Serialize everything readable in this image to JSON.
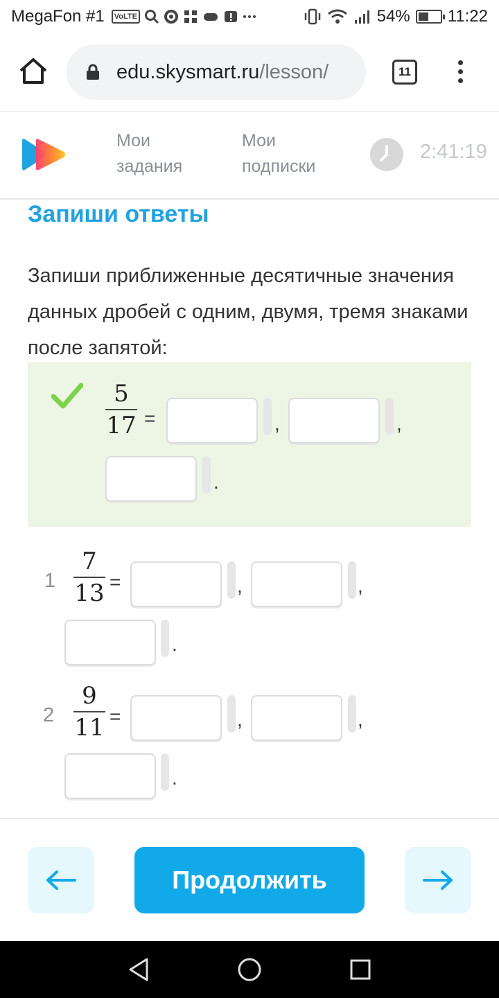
{
  "status_bar": {
    "carrier": "MegaFon #1",
    "volte": "VoLTE",
    "battery_percent": "54%",
    "battery_level": 0.54,
    "time": "11:22"
  },
  "browser": {
    "url_domain": "edu.skysmart.ru",
    "url_path": "/lesson/",
    "tab_count": "11"
  },
  "header": {
    "nav": [
      {
        "line1": "Мои",
        "line2": "задания"
      },
      {
        "line1": "Мои",
        "line2": "подписки"
      }
    ],
    "timer": "2:41:19"
  },
  "main": {
    "section_title": "Запиши ответы",
    "instruction": "Запиши приближенные десятичные значения данных дробей с одним, двумя, тремя знаками после запятой:",
    "example": {
      "numerator": "5",
      "denominator": "17",
      "equals": "=",
      "sep1": ",",
      "sep2": ",",
      "end": "."
    },
    "tasks": [
      {
        "number": "1",
        "numerator": "7",
        "denominator": "13",
        "equals": "=",
        "sep1": ",",
        "sep2": ",",
        "end": "."
      },
      {
        "number": "2",
        "numerator": "9",
        "denominator": "11",
        "equals": "=",
        "sep1": ",",
        "sep2": ",",
        "end": "."
      }
    ]
  },
  "footer": {
    "continue_label": "Продолжить"
  },
  "colors": {
    "accent": "#1fa3e1",
    "button": "#12a9e8",
    "example_bg": "#edf5e5",
    "check": "#7ed14a"
  },
  "icons": [
    "home-icon",
    "lock-icon",
    "tabs-icon",
    "overflow-menu-icon",
    "clock-icon",
    "checkmark-icon",
    "arrow-left-icon",
    "arrow-right-icon",
    "back-icon",
    "home-circle-icon",
    "recents-icon"
  ]
}
